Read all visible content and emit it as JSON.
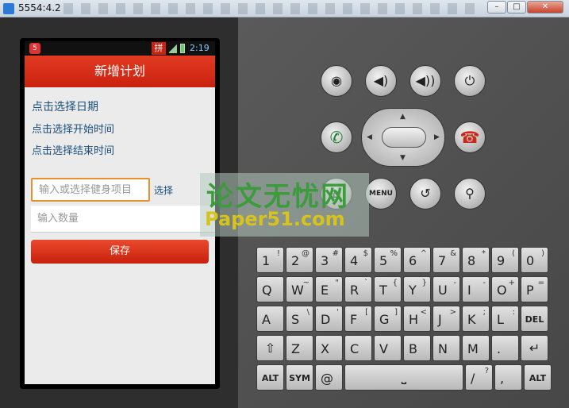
{
  "window": {
    "title": "5554:4.2",
    "min": "–",
    "max": "□",
    "close": "✕"
  },
  "statusbar": {
    "notif": "5",
    "ime": "拼",
    "time": "2:19"
  },
  "app": {
    "title": "新增计划",
    "select_date": "点击选择日期",
    "select_start": "点击选择开始时间",
    "select_end": "点击选择结束时间",
    "project_placeholder": "输入或选择健身项目",
    "choose_label": "选择",
    "qty_placeholder": "输入数量",
    "save_label": "保存"
  },
  "hardware": {
    "camera": "◉",
    "vol_down": "◀)",
    "vol_up": "◀))",
    "power": "⏻",
    "call": "✆",
    "end_call": "☎",
    "home": "⌂",
    "menu": "MENU",
    "back": "↺",
    "search": "⚲"
  },
  "watermark": {
    "cn": "论文无忧网",
    "en": "Paper51.com"
  },
  "keyboard": {
    "row1": [
      [
        "1",
        "!"
      ],
      [
        "2",
        "@"
      ],
      [
        "3",
        "#"
      ],
      [
        "4",
        "$"
      ],
      [
        "5",
        "%"
      ],
      [
        "6",
        "^"
      ],
      [
        "7",
        "&"
      ],
      [
        "8",
        "*"
      ],
      [
        "9",
        "("
      ],
      [
        "0",
        ")"
      ]
    ],
    "row2": [
      [
        "Q",
        ""
      ],
      [
        "W",
        "~"
      ],
      [
        "E",
        "\""
      ],
      [
        "R",
        "`"
      ],
      [
        "T",
        "{"
      ],
      [
        "Y",
        "}"
      ],
      [
        "U",
        "-"
      ],
      [
        "I",
        "-"
      ],
      [
        "O",
        "+"
      ],
      [
        "P",
        "="
      ]
    ],
    "row3": [
      [
        "A",
        ""
      ],
      [
        "S",
        "\\"
      ],
      [
        "D",
        "'"
      ],
      [
        "F",
        "["
      ],
      [
        "G",
        "]"
      ],
      [
        "H",
        "<"
      ],
      [
        "J",
        ">"
      ],
      [
        "K",
        ";"
      ],
      [
        "L",
        ":"
      ],
      [
        "DEL",
        ""
      ]
    ],
    "row4": [
      [
        "⇧",
        ""
      ],
      [
        "Z",
        ""
      ],
      [
        "X",
        ""
      ],
      [
        "C",
        ""
      ],
      [
        "V",
        ""
      ],
      [
        "B",
        ""
      ],
      [
        "N",
        ""
      ],
      [
        "M",
        ""
      ],
      [
        ".",
        ""
      ],
      [
        "↵",
        ""
      ]
    ],
    "row5": [
      [
        "ALT",
        ""
      ],
      [
        "SYM",
        ""
      ],
      [
        "@",
        ""
      ],
      [
        "⎵",
        ""
      ],
      [
        "/",
        "?"
      ],
      [
        ",",
        ""
      ],
      [
        "ALT",
        ""
      ]
    ]
  }
}
